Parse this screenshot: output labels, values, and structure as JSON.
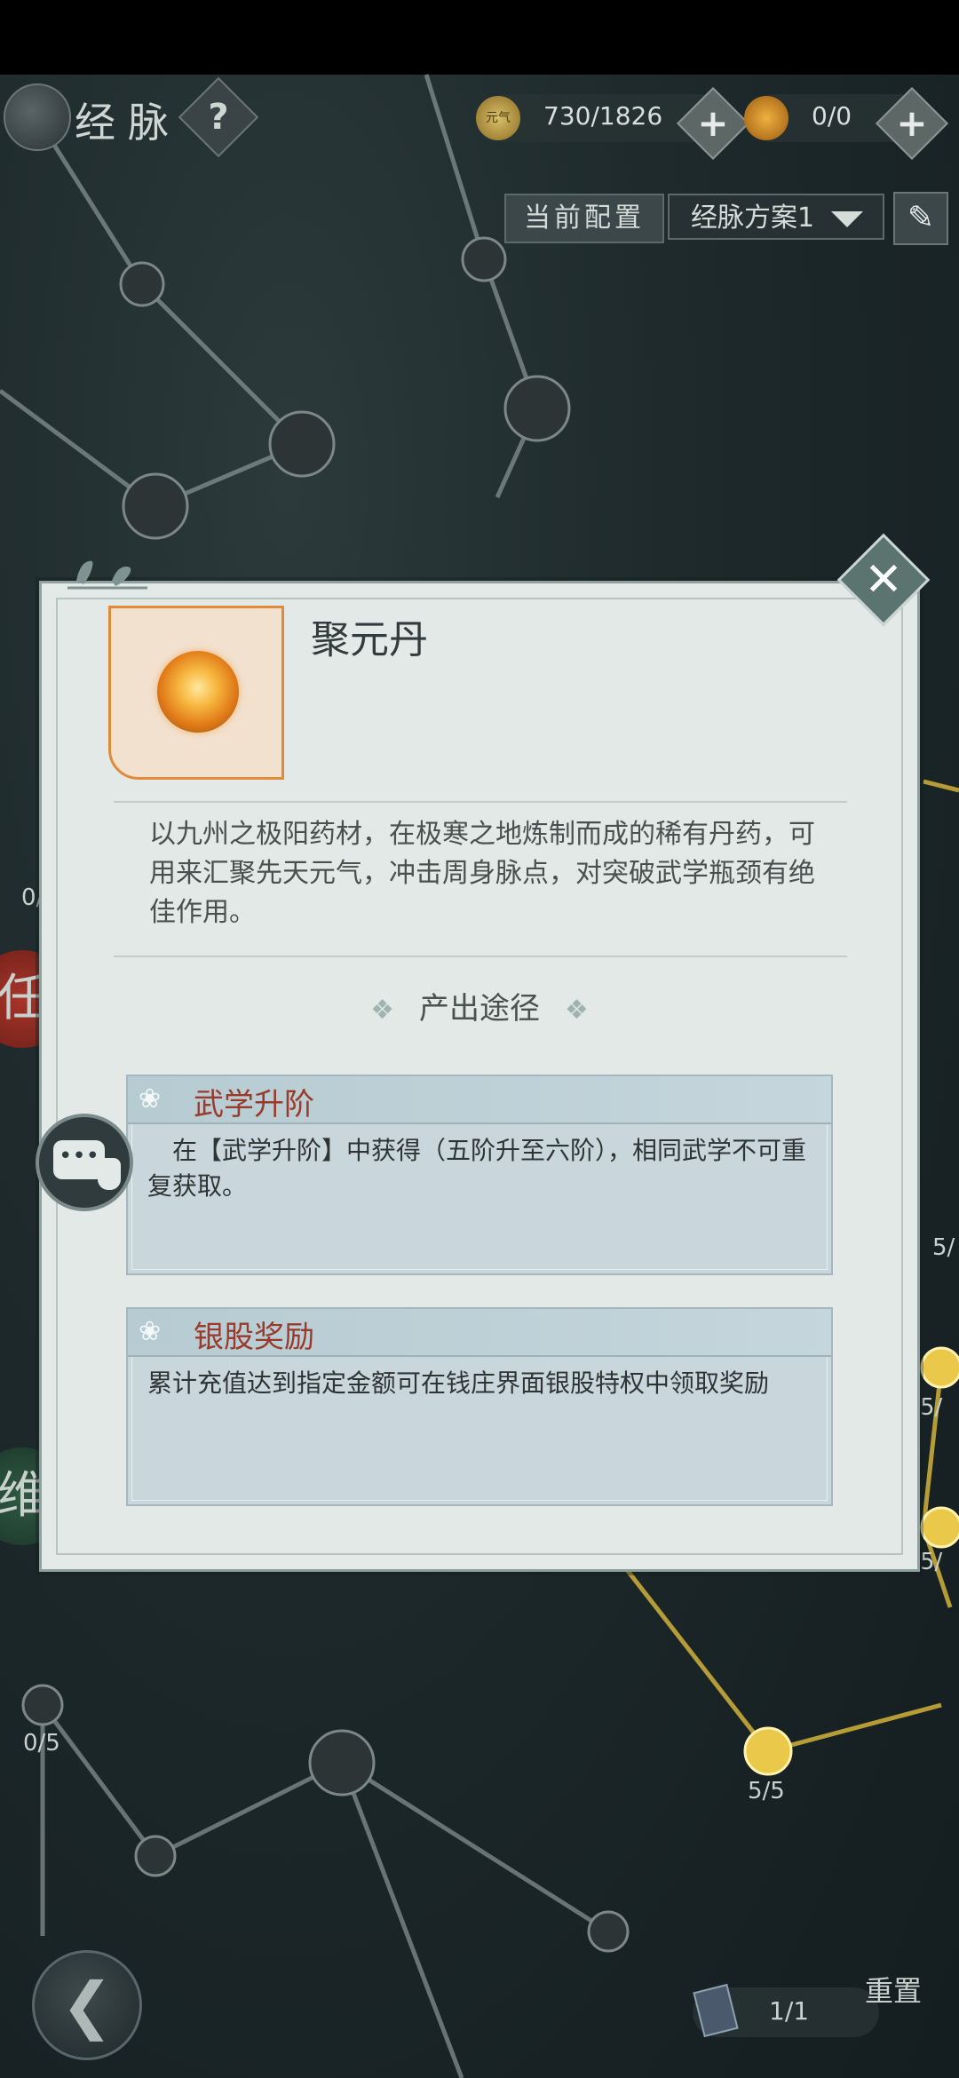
{
  "header": {
    "title": "经脉",
    "help_label": "?",
    "resource1": {
      "value": "730/1826",
      "coin_label": "元气"
    },
    "resource2": {
      "value": "0/0"
    },
    "plus_label": "+"
  },
  "config": {
    "current_label": "当前配置",
    "plan_value": "经脉方案1",
    "edit_label": "✎"
  },
  "map_labels": [
    "0/",
    "0/5",
    "5/5",
    "5/",
    "5/",
    "5/"
  ],
  "side_badges": [
    "任",
    "维"
  ],
  "modal": {
    "close_label": "✕",
    "item": {
      "name": "聚元丹",
      "description": "以九州之极阳药材，在极寒之地炼制而成的稀有丹药，可用来汇聚先天元气，冲击周身脉点，对突破武学瓶颈有绝佳作用。"
    },
    "source_section_title": "产出途径",
    "deco": "❖",
    "sources": [
      {
        "title": "武学升阶",
        "body": "在【武学升阶】中获得（五阶升至六阶），相同武学不可重复获取。"
      },
      {
        "title": "银股奖励",
        "body": "累计充值达到指定金额可在钱庄界面银股特权中领取奖励"
      }
    ]
  },
  "chat": {
    "label": "•••"
  },
  "footer": {
    "back_label": "❮",
    "page": "1/1",
    "reset_label": "重置"
  },
  "colors": {
    "accent_orange": "#e08a3a",
    "source_title_red": "#9a3a2a",
    "panel_bg": "#e3e9e6",
    "card_bg": "#c9d7dc"
  }
}
